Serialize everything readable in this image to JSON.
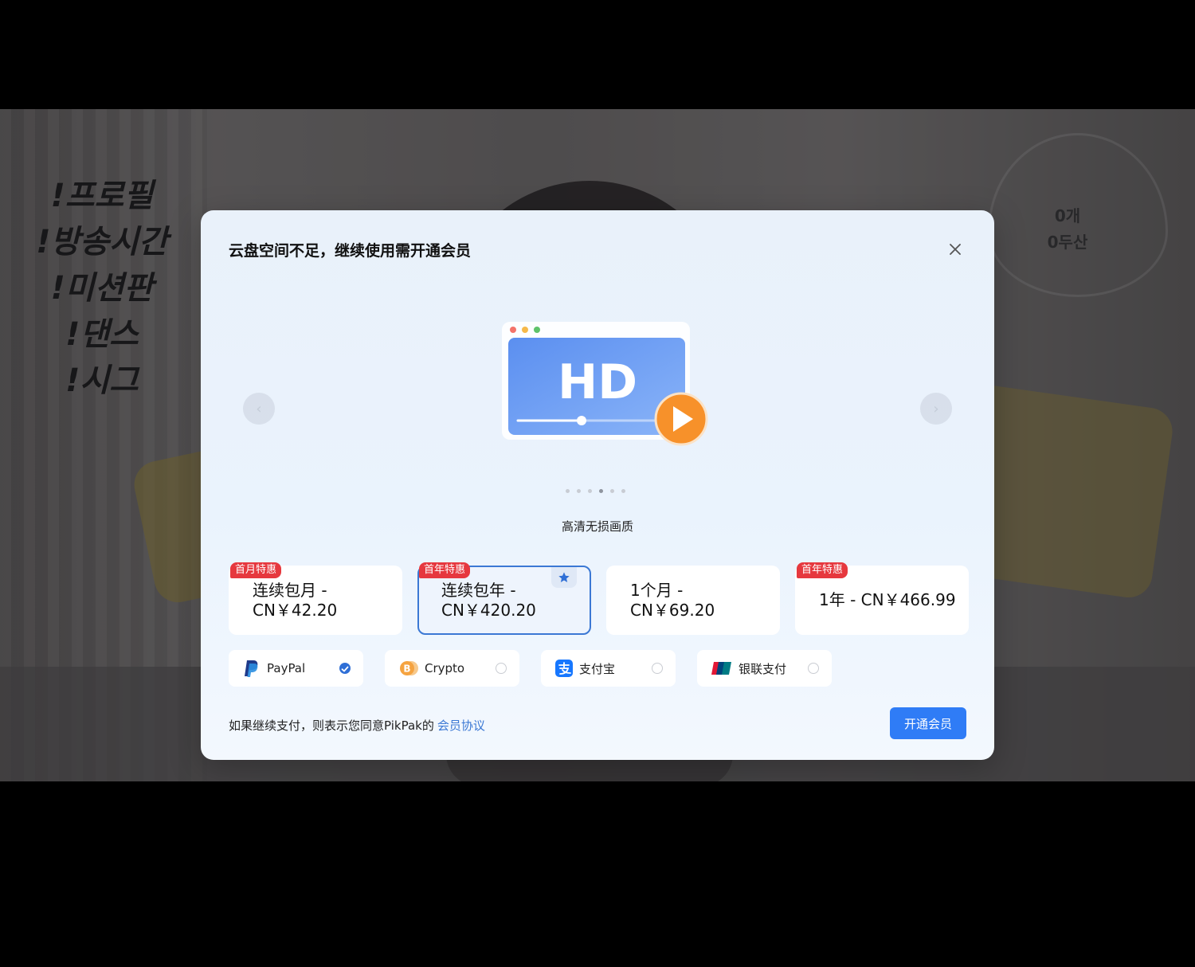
{
  "background": {
    "korean_lines": [
      "!프로필",
      "!방송시간",
      "!미션판",
      "!댄스",
      "!시그"
    ],
    "heart_lines": [
      "0개",
      "0두산"
    ]
  },
  "modal": {
    "title": "云盘空间不足，继续使用需开通会员",
    "close_icon": "close-icon",
    "carousel": {
      "slide_text": "HD",
      "caption": "高清无损画质",
      "dot_count": 6,
      "active_dot": 3,
      "prev_arrow": "‹",
      "next_arrow": "›"
    },
    "plans": [
      {
        "label": "连续包月 - CN￥42.20",
        "line1": "连续包月 -",
        "line2": "CN￥42.20",
        "badge": "首月特惠",
        "selected": false
      },
      {
        "label": "连续包年 - CN￥420.20",
        "line1": "连续包年 -",
        "line2": "CN￥420.20",
        "badge": "首年特惠",
        "selected": true
      },
      {
        "label": "1个月 - CN￥69.20",
        "line1": "1个月 -",
        "line2": "CN￥69.20",
        "badge": "",
        "selected": false
      },
      {
        "label": "1年 - CN￥466.99",
        "line1": "1年 - CN￥466.99",
        "line2": "",
        "badge": "首年特惠",
        "selected": false
      }
    ],
    "payments": [
      {
        "label": "PayPal",
        "icon": "paypal-icon",
        "checked": true
      },
      {
        "label": "Crypto",
        "icon": "bitcoin-icon",
        "checked": false
      },
      {
        "label": "支付宝",
        "icon": "alipay-icon",
        "checked": false
      },
      {
        "label": "银联支付",
        "icon": "unionpay-icon",
        "checked": false
      }
    ],
    "agreement_text": "如果继续支付，则表示您同意PikPak的",
    "agreement_link": "会员协议",
    "subscribe_button": "开通会员"
  },
  "colors": {
    "primary": "#2f7cf6",
    "badge": "#e6383e",
    "play": "#f7912a"
  }
}
